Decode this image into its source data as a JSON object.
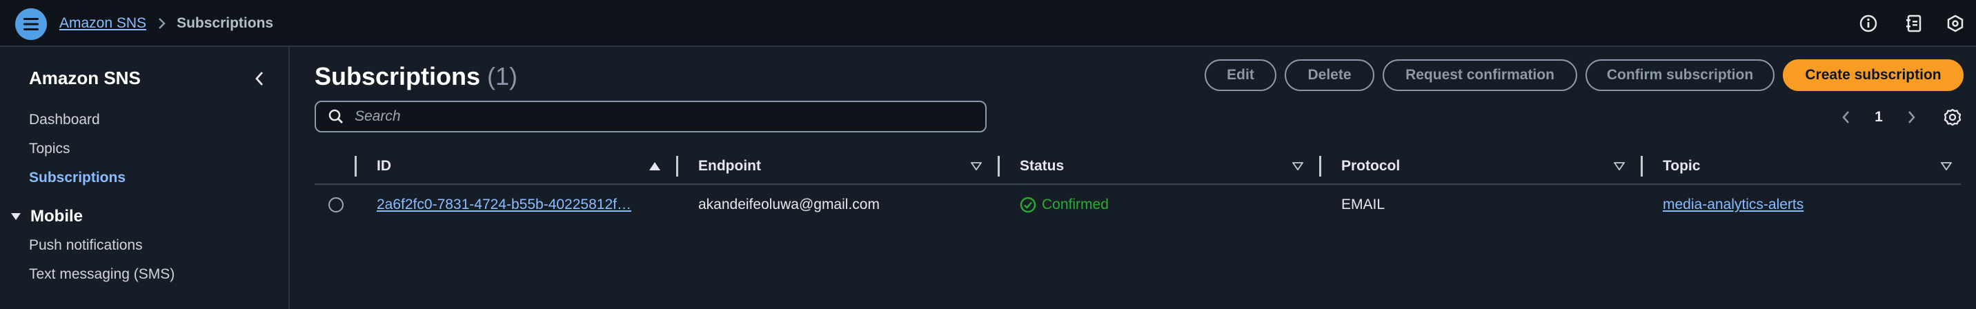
{
  "header": {
    "breadcrumb_service": "Amazon SNS",
    "breadcrumb_current": "Subscriptions",
    "icons": [
      "menu-icon",
      "chevron-right-icon",
      "info-icon",
      "notes-icon",
      "settings-hex-icon"
    ]
  },
  "sidebar": {
    "title": "Amazon SNS",
    "items": [
      {
        "label": "Dashboard",
        "active": false
      },
      {
        "label": "Topics",
        "active": false
      },
      {
        "label": "Subscriptions",
        "active": true
      }
    ],
    "section": {
      "label": "Mobile",
      "expanded": true,
      "items": [
        {
          "label": "Push notifications"
        },
        {
          "label": "Text messaging (SMS)"
        }
      ]
    }
  },
  "main": {
    "title": "Subscriptions",
    "count": "(1)",
    "buttons": {
      "edit": "Edit",
      "delete": "Delete",
      "request_confirmation": "Request confirmation",
      "confirm_subscription": "Confirm subscription",
      "create_subscription": "Create subscription"
    },
    "search": {
      "placeholder": "Search",
      "value": ""
    },
    "pagination": {
      "current_page": "1"
    }
  },
  "table": {
    "columns": [
      "ID",
      "Endpoint",
      "Status",
      "Protocol",
      "Topic"
    ],
    "sorted_column": "ID",
    "rows": [
      {
        "id": "2a6f2fc0-7831-4724-b55b-40225812f…",
        "endpoint": "akandeifeoluwa@gmail.com",
        "status": "Confirmed",
        "protocol": "EMAIL",
        "topic": "media-analytics-alerts",
        "selected": false
      }
    ]
  },
  "colors": {
    "background": "#161d26",
    "topbar": "#0f141a",
    "link": "#89bdff",
    "primary_button": "#f89c24",
    "status_confirmed": "#29ad32"
  }
}
